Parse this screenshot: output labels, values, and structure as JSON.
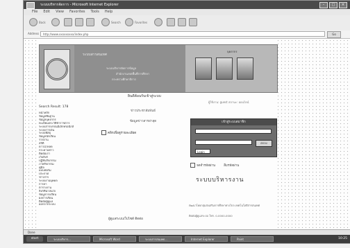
{
  "window": {
    "title": "ระบบบริหารจัดการ - Microsoft Internet Explorer"
  },
  "menu": [
    "File",
    "Edit",
    "View",
    "Favorites",
    "Tools",
    "Help"
  ],
  "toolbar": {
    "back": "Back",
    "search": "Search",
    "favorites": "Favorites"
  },
  "address": {
    "label": "Address",
    "url": "http://www.xxxxxxxxx/index.php",
    "go": "Go"
  },
  "banner": {
    "heading": "ระบบสารสนเทศ",
    "line1": "ระบบบริหารจัดการข้อมูล",
    "line2": "สำนักงานเขตพื้นที่การศึกษา",
    "line3": "กระทรวงศึกษาธิการ",
    "right_label": "บุคลากร"
  },
  "under_banner": "ยินดีต้อนรับเข้าสู่ระบบ",
  "right_note": "ผู้ใช้งาน: guest  สถานะ: ออนไลน์",
  "left_menu": {
    "header": "Search Result: 178",
    "items": [
      "หน้าหลัก",
      "ข้อมูลพื้นฐาน",
      "ข้อมูลบุคลากร",
      "ทะเบียนประวัติข้าราชการ",
      "ระบบสารบรรณอิเล็กทรอนิกส์",
      "ระบบการเงิน",
      "ระบบพัสดุ",
      "ข้อมูลนักเรียน",
      "รายงาน",
      "สถิติ",
      "ดาวน์โหลด",
      "กระดานข่าว",
      "ติดต่อเรา",
      "เว็บลิงก์",
      "ปฏิทินกิจกรรม",
      "ภาพกิจกรรม",
      "คู่มือ",
      "แบบฟอร์ม",
      "ประกาศ",
      "ข่าวสาร",
      "ระบบงานบุคคล",
      "การลา",
      "ตารางงาน",
      "ลิงก์ที่น่าสนใจ",
      "ข้อมูลโรงเรียน",
      "ผลการเรียน",
      "ติดต่อผู้ดูแล",
      "ออกจากระบบ"
    ]
  },
  "middle": {
    "line1": "ข่าวประชาสัมพันธ์",
    "line2": "ข้อมูลข่าวสารล่าสุด",
    "link": "คลิกเพื่อดูรายละเอียด"
  },
  "login": {
    "title": "เข้าสู่ระบบสมาชิก",
    "user_placeholder": "",
    "pass_placeholder": "",
    "field3": "Login",
    "button": "ตกลง"
  },
  "below_login": {
    "remember": "จดจำรหัสผ่าน",
    "forgot": "ลืมรหัสผ่าน"
  },
  "big_title": "ระบบบริหารงาน",
  "small_lines": [
    "พัฒนาโดยกลุ่มส่งเสริมการศึกษาทางไกล เทคโนโลยีสารสนเทศ",
    "ติดต่อผู้ดูแลระบบ โทร. 0-0000-0000"
  ],
  "bottom_mid": "ผู้ดูแลระบบเว็บไซต์  ติดต่อ",
  "status": "Done",
  "taskbar": {
    "start": "start",
    "tasks": [
      "ระบบบริหาร...",
      "Microsoft Word",
      "ระบบสารสนเทศ...",
      "Internet Explorer",
      "Paint"
    ],
    "clock": "10:25"
  }
}
